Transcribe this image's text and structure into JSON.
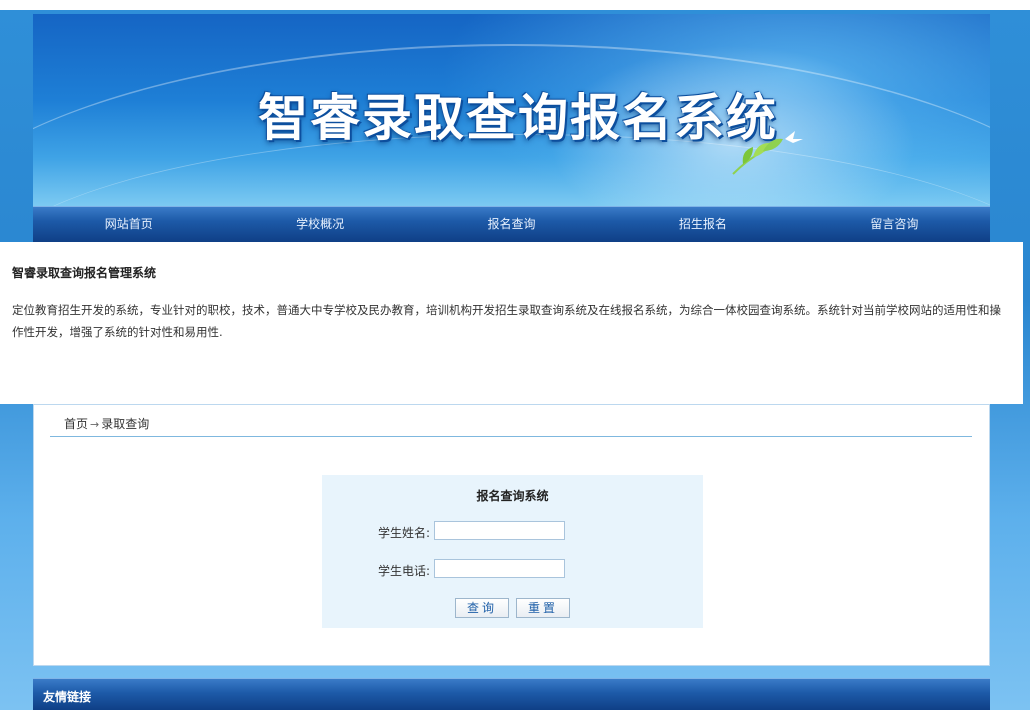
{
  "banner": {
    "title": "智睿录取查询报名系统"
  },
  "nav": {
    "items": [
      "网站首页",
      "学校概况",
      "报名查询",
      "招生报名",
      "留言咨询"
    ]
  },
  "intro": {
    "title": "智睿录取查询报名管理系统",
    "text": "定位教育招生开发的系统，专业针对的职校，技术，普通大中专学校及民办教育，培训机构开发招生录取查询系统及在线报名系统，为综合一体校园查询系统。系统针对当前学校网站的适用性和操作性开发，增强了系统的针对性和易用性."
  },
  "breadcrumb": {
    "home": "首页",
    "arrow": "→",
    "current": "录取查询"
  },
  "form": {
    "title": "报名查询系统",
    "name_label": "学生姓名:",
    "name_value": "",
    "phone_label": "学生电话:",
    "phone_value": "",
    "submit_label": "查询",
    "reset_label": "重置"
  },
  "footer": {
    "friend_links_title": "友情链接"
  },
  "colors": {
    "nav_dark": "#0f3f86",
    "nav_light": "#3a7bc8",
    "form_bg": "#e8f4fc",
    "button_text": "#1e5fa8"
  },
  "icons": {
    "banner_decoration": "leaf-dove-icon"
  }
}
